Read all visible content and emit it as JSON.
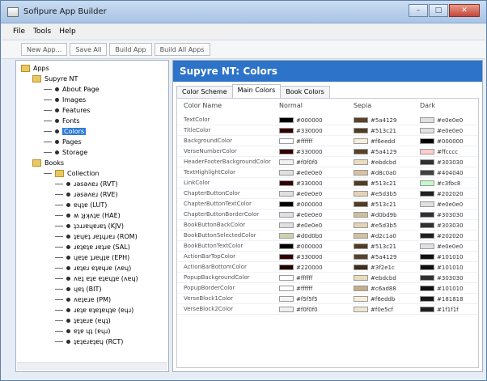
{
  "window": {
    "title": "Sofipure App Builder"
  },
  "menu": [
    "File",
    "Tools",
    "Help"
  ],
  "toolbar": [
    "New App...",
    "Save All",
    "Build App",
    "Build All Apps"
  ],
  "tree": [
    {
      "label": "Apps",
      "depth": 0,
      "type": "folder"
    },
    {
      "label": "Supyre NT",
      "depth": 1,
      "type": "folder"
    },
    {
      "label": "About Page",
      "depth": 2,
      "type": "item"
    },
    {
      "label": "Images",
      "depth": 2,
      "type": "item"
    },
    {
      "label": "Features",
      "depth": 2,
      "type": "item"
    },
    {
      "label": "Fonts",
      "depth": 2,
      "type": "item"
    },
    {
      "label": "Colors",
      "depth": 2,
      "type": "item",
      "selected": true
    },
    {
      "label": "Pages",
      "depth": 2,
      "type": "item"
    },
    {
      "label": "Storage",
      "depth": 2,
      "type": "item"
    },
    {
      "label": "Books",
      "depth": 1,
      "type": "folder"
    },
    {
      "label": "Collection",
      "depth": 2,
      "type": "folder"
    },
    {
      "label": "ɹǝsǝʌɐɹ (RVT)",
      "depth": 3,
      "type": "item"
    },
    {
      "label": "ɹǝsǝʌɐɹ (RVE)",
      "depth": 3,
      "type": "item"
    },
    {
      "label": "ɐɥʇɐ (LUT)",
      "depth": 3,
      "type": "item"
    },
    {
      "label": "ʍ ʇɟʞʌʇɐ (HAE)",
      "depth": 3,
      "type": "item"
    },
    {
      "label": "ʇɔɹɹɐɥɐɹɐʇ (KJV)",
      "depth": 3,
      "type": "item"
    },
    {
      "label": "ʇɐɥɐʇ ɹɐʇɥɹɐɹ (ROM)",
      "depth": 3,
      "type": "item"
    },
    {
      "label": "ɹɐʇɐʇɐ ɹɐʇɹɐ (SAL)",
      "depth": 3,
      "type": "item"
    },
    {
      "label": "ɥɐʇɐ ʇɹɐɥʇɐ (EPH)",
      "depth": 3,
      "type": "item"
    },
    {
      "label": "ɹɐʇɐɹ ɐʇɐɥɹɐ (ʌɐɥ)",
      "depth": 3,
      "type": "item"
    },
    {
      "label": "ʌɐʇ ɐʇɐ ɐʇɐɥʇɐ (ʌɐɥ)",
      "depth": 3,
      "type": "item"
    },
    {
      "label": "ɥɐʇ (BIT)",
      "depth": 3,
      "type": "item"
    },
    {
      "label": "ʌɐʇɐɹɐ (PM)",
      "depth": 3,
      "type": "item"
    },
    {
      "label": "ɹɐʇɐ ɐʇɐʇɐɥʇɐ (ɐɥɹ)",
      "depth": 3,
      "type": "item"
    },
    {
      "label": "ʇɐʇɐɹɐ (ɐɥʇ)",
      "depth": 3,
      "type": "item"
    },
    {
      "label": "ɐʇɐ ɥʇ (ɐɥɹ)",
      "depth": 3,
      "type": "item"
    },
    {
      "label": "ʇɐʇɐɹɐʇɐɥ (RCT)",
      "depth": 3,
      "type": "item"
    }
  ],
  "panel": {
    "title": "Supyre NT: Colors"
  },
  "tabs": [
    "Color Scheme",
    "Main Colors",
    "Book Colors"
  ],
  "columns": [
    "Color Name",
    "Normal",
    "Sepia",
    "Dark"
  ],
  "colors": [
    {
      "name": "TextColor",
      "normal": "#000000",
      "sepia": "#5a4129",
      "dark": "#e0e0e0"
    },
    {
      "name": "TitleColor",
      "normal": "#330000",
      "sepia": "#513c21",
      "dark": "#e0e0e0"
    },
    {
      "name": "BackgroundColor",
      "normal": "#ffffff",
      "sepia": "#f6eedd",
      "dark": "#000000"
    },
    {
      "name": "VerseNumberColor",
      "normal": "#330000",
      "sepia": "#5a4129",
      "dark": "#ffcccc"
    },
    {
      "name": "HeaderFooterBackgroundColor",
      "normal": "#f0f0f0",
      "sepia": "#ebdcbd",
      "dark": "#303030"
    },
    {
      "name": "TextHighlightColor",
      "normal": "#e0e0e0",
      "sepia": "#d8c0a0",
      "dark": "#404040"
    },
    {
      "name": "LinkColor",
      "normal": "#330000",
      "sepia": "#513c21",
      "dark": "#c3fbc8"
    },
    {
      "name": "ChapterButtonColor",
      "normal": "#e0e0e0",
      "sepia": "#e5d3b5",
      "dark": "#202020"
    },
    {
      "name": "ChapterButtonTextColor",
      "normal": "#000000",
      "sepia": "#513c21",
      "dark": "#e0e0e0"
    },
    {
      "name": "ChapterButtonBorderColor",
      "normal": "#e0e0e0",
      "sepia": "#d0bd9b",
      "dark": "#303030"
    },
    {
      "name": "BookButtonBackColor",
      "normal": "#e0e0e0",
      "sepia": "#e5d3b5",
      "dark": "#303030"
    },
    {
      "name": "BookButtonSelectedColor",
      "normal": "#d0d0b0",
      "sepia": "#d2c1a0",
      "dark": "#202020"
    },
    {
      "name": "BookButtonTextColor",
      "normal": "#000000",
      "sepia": "#513c21",
      "dark": "#e0e0e0"
    },
    {
      "name": "ActionBarTopColor",
      "normal": "#330000",
      "sepia": "#5a4129",
      "dark": "#101010"
    },
    {
      "name": "ActionBarBottomColor",
      "normal": "#220000",
      "sepia": "#3f2e1c",
      "dark": "#101010"
    },
    {
      "name": "PopupBackgroundColor",
      "normal": "#ffffff",
      "sepia": "#ebdcbd",
      "dark": "#303030"
    },
    {
      "name": "PopupBorderColor",
      "normal": "#ffffff",
      "sepia": "#c6ad88",
      "dark": "#101010"
    },
    {
      "name": "VerseBlock1Color",
      "normal": "#f5f5f5",
      "sepia": "#f6eddb",
      "dark": "#181818"
    },
    {
      "name": "VerseBlock2Color",
      "normal": "#f0f0f0",
      "sepia": "#f0e5cf",
      "dark": "#1f1f1f"
    }
  ]
}
